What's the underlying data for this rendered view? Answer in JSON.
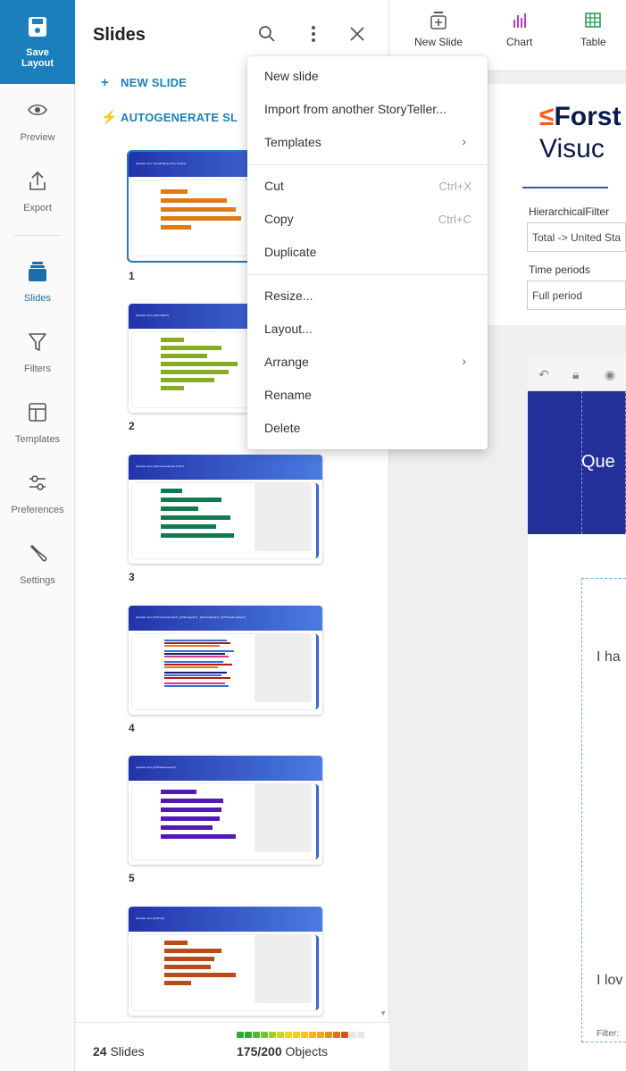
{
  "rail": {
    "save_label": "Save\nLayout",
    "items": [
      {
        "label": "Preview",
        "icon": "eye-icon"
      },
      {
        "label": "Export",
        "icon": "export-icon"
      },
      {
        "label": "Slides",
        "icon": "slides-icon"
      },
      {
        "label": "Filters",
        "icon": "filter-icon"
      },
      {
        "label": "Templates",
        "icon": "templates-icon"
      },
      {
        "label": "Preferences",
        "icon": "sliders-icon"
      },
      {
        "label": "Settings",
        "icon": "wrench-icon"
      }
    ]
  },
  "panel": {
    "title": "Slides",
    "new_slide": "NEW SLIDE",
    "autogenerate": "AUTOGENERATE SL",
    "thumbnails": [
      {
        "number": "1",
        "title": "Question text: Overall liking of the Product",
        "color": "#e07b12",
        "selected": true
      },
      {
        "number": "2",
        "title": "Question text: [Q2Fruitlike?]",
        "color": "#84ab22",
        "selected": false
      },
      {
        "number": "3",
        "title": "Question text: [Q3Unaccustomed Fruit?]",
        "color": "#117a4e",
        "selected": false
      },
      {
        "number": "4",
        "title": "Question text: [Q7Unaccustomed?] , [Q7Energetic?] , [Q7Familiarity?] , [Q7Transformation?]",
        "color": "multi",
        "selected": false
      },
      {
        "number": "5",
        "title": "Question text: [Q7Pleasantness?]",
        "color": "#5418b5",
        "selected": false
      },
      {
        "number": "",
        "title": "Question text: [Q7Hue?]",
        "color": "#b84c18",
        "selected": false
      }
    ],
    "footer": {
      "slides_count": "24",
      "slides_label": "Slides",
      "objects_count": "175/200",
      "objects_label": "Objects"
    }
  },
  "toolbar": {
    "items": [
      {
        "label": "New Slide",
        "icon": "new-slide-icon"
      },
      {
        "label": "Chart",
        "icon": "chart-icon"
      },
      {
        "label": "Table",
        "icon": "table-icon"
      }
    ]
  },
  "canvas": {
    "brand_line1_accent": "≤",
    "brand_line1": "Forst",
    "brand_line2": "Visuc",
    "filter1_label": "HierarchicalFilter",
    "filter1_value": "Total -> United Sta",
    "filter2_label": "Time periods",
    "filter2_value": "Full period",
    "slide_heading": "Que",
    "text_a": "I ha",
    "text_b": "I lov",
    "filter_text": "Filter:"
  },
  "menu": {
    "items": [
      {
        "label": "New slide"
      },
      {
        "label": "Import from another StoryTeller..."
      },
      {
        "label": "Templates",
        "submenu": true
      },
      {
        "label": "Cut",
        "shortcut": "Ctrl+X"
      },
      {
        "label": "Copy",
        "shortcut": "Ctrl+C"
      },
      {
        "label": "Duplicate"
      },
      {
        "label": "Resize..."
      },
      {
        "label": "Layout..."
      },
      {
        "label": "Arrange",
        "submenu": true
      },
      {
        "label": "Rename"
      },
      {
        "label": "Delete"
      }
    ]
  },
  "colors": {
    "accent": "#1b7fbd",
    "brand_dark": "#0b1a4d",
    "brand_orange": "#ff5a1e",
    "slide_header": "#23309a"
  }
}
